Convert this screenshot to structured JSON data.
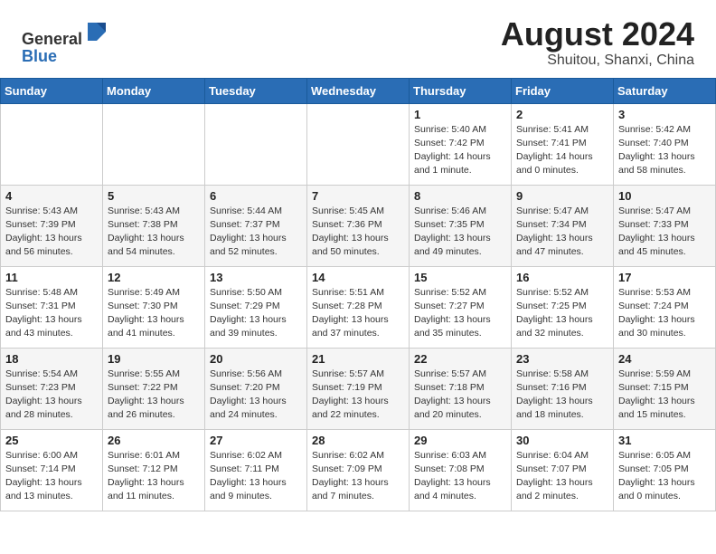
{
  "header": {
    "logo_line1": "General",
    "logo_line2": "Blue",
    "month_year": "August 2024",
    "location": "Shuitou, Shanxi, China"
  },
  "days_of_week": [
    "Sunday",
    "Monday",
    "Tuesday",
    "Wednesday",
    "Thursday",
    "Friday",
    "Saturday"
  ],
  "weeks": [
    [
      {
        "day": "",
        "info": ""
      },
      {
        "day": "",
        "info": ""
      },
      {
        "day": "",
        "info": ""
      },
      {
        "day": "",
        "info": ""
      },
      {
        "day": "1",
        "info": "Sunrise: 5:40 AM\nSunset: 7:42 PM\nDaylight: 14 hours\nand 1 minute."
      },
      {
        "day": "2",
        "info": "Sunrise: 5:41 AM\nSunset: 7:41 PM\nDaylight: 14 hours\nand 0 minutes."
      },
      {
        "day": "3",
        "info": "Sunrise: 5:42 AM\nSunset: 7:40 PM\nDaylight: 13 hours\nand 58 minutes."
      }
    ],
    [
      {
        "day": "4",
        "info": "Sunrise: 5:43 AM\nSunset: 7:39 PM\nDaylight: 13 hours\nand 56 minutes."
      },
      {
        "day": "5",
        "info": "Sunrise: 5:43 AM\nSunset: 7:38 PM\nDaylight: 13 hours\nand 54 minutes."
      },
      {
        "day": "6",
        "info": "Sunrise: 5:44 AM\nSunset: 7:37 PM\nDaylight: 13 hours\nand 52 minutes."
      },
      {
        "day": "7",
        "info": "Sunrise: 5:45 AM\nSunset: 7:36 PM\nDaylight: 13 hours\nand 50 minutes."
      },
      {
        "day": "8",
        "info": "Sunrise: 5:46 AM\nSunset: 7:35 PM\nDaylight: 13 hours\nand 49 minutes."
      },
      {
        "day": "9",
        "info": "Sunrise: 5:47 AM\nSunset: 7:34 PM\nDaylight: 13 hours\nand 47 minutes."
      },
      {
        "day": "10",
        "info": "Sunrise: 5:47 AM\nSunset: 7:33 PM\nDaylight: 13 hours\nand 45 minutes."
      }
    ],
    [
      {
        "day": "11",
        "info": "Sunrise: 5:48 AM\nSunset: 7:31 PM\nDaylight: 13 hours\nand 43 minutes."
      },
      {
        "day": "12",
        "info": "Sunrise: 5:49 AM\nSunset: 7:30 PM\nDaylight: 13 hours\nand 41 minutes."
      },
      {
        "day": "13",
        "info": "Sunrise: 5:50 AM\nSunset: 7:29 PM\nDaylight: 13 hours\nand 39 minutes."
      },
      {
        "day": "14",
        "info": "Sunrise: 5:51 AM\nSunset: 7:28 PM\nDaylight: 13 hours\nand 37 minutes."
      },
      {
        "day": "15",
        "info": "Sunrise: 5:52 AM\nSunset: 7:27 PM\nDaylight: 13 hours\nand 35 minutes."
      },
      {
        "day": "16",
        "info": "Sunrise: 5:52 AM\nSunset: 7:25 PM\nDaylight: 13 hours\nand 32 minutes."
      },
      {
        "day": "17",
        "info": "Sunrise: 5:53 AM\nSunset: 7:24 PM\nDaylight: 13 hours\nand 30 minutes."
      }
    ],
    [
      {
        "day": "18",
        "info": "Sunrise: 5:54 AM\nSunset: 7:23 PM\nDaylight: 13 hours\nand 28 minutes."
      },
      {
        "day": "19",
        "info": "Sunrise: 5:55 AM\nSunset: 7:22 PM\nDaylight: 13 hours\nand 26 minutes."
      },
      {
        "day": "20",
        "info": "Sunrise: 5:56 AM\nSunset: 7:20 PM\nDaylight: 13 hours\nand 24 minutes."
      },
      {
        "day": "21",
        "info": "Sunrise: 5:57 AM\nSunset: 7:19 PM\nDaylight: 13 hours\nand 22 minutes."
      },
      {
        "day": "22",
        "info": "Sunrise: 5:57 AM\nSunset: 7:18 PM\nDaylight: 13 hours\nand 20 minutes."
      },
      {
        "day": "23",
        "info": "Sunrise: 5:58 AM\nSunset: 7:16 PM\nDaylight: 13 hours\nand 18 minutes."
      },
      {
        "day": "24",
        "info": "Sunrise: 5:59 AM\nSunset: 7:15 PM\nDaylight: 13 hours\nand 15 minutes."
      }
    ],
    [
      {
        "day": "25",
        "info": "Sunrise: 6:00 AM\nSunset: 7:14 PM\nDaylight: 13 hours\nand 13 minutes."
      },
      {
        "day": "26",
        "info": "Sunrise: 6:01 AM\nSunset: 7:12 PM\nDaylight: 13 hours\nand 11 minutes."
      },
      {
        "day": "27",
        "info": "Sunrise: 6:02 AM\nSunset: 7:11 PM\nDaylight: 13 hours\nand 9 minutes."
      },
      {
        "day": "28",
        "info": "Sunrise: 6:02 AM\nSunset: 7:09 PM\nDaylight: 13 hours\nand 7 minutes."
      },
      {
        "day": "29",
        "info": "Sunrise: 6:03 AM\nSunset: 7:08 PM\nDaylight: 13 hours\nand 4 minutes."
      },
      {
        "day": "30",
        "info": "Sunrise: 6:04 AM\nSunset: 7:07 PM\nDaylight: 13 hours\nand 2 minutes."
      },
      {
        "day": "31",
        "info": "Sunrise: 6:05 AM\nSunset: 7:05 PM\nDaylight: 13 hours\nand 0 minutes."
      }
    ]
  ]
}
